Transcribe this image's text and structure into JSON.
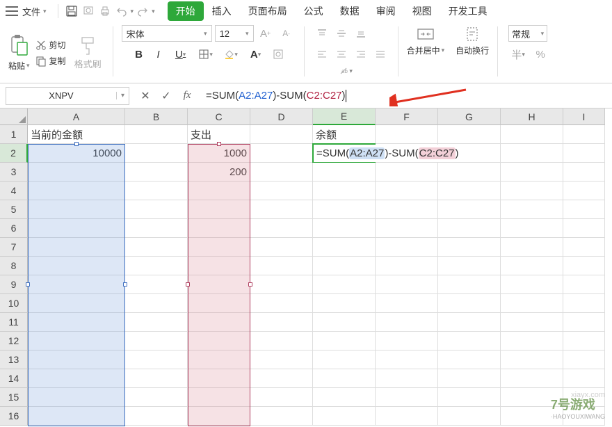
{
  "menu": {
    "file": "文件",
    "tabs": [
      "开始",
      "插入",
      "页面布局",
      "公式",
      "数据",
      "审阅",
      "视图",
      "开发工具"
    ],
    "active_tab": 0
  },
  "clipboard": {
    "paste": "粘贴",
    "cut": "剪切",
    "copy": "复制",
    "format_painter": "格式刷"
  },
  "font": {
    "name": "宋体",
    "size": "12",
    "bold": "B",
    "italic": "I",
    "underline": "U"
  },
  "merge": {
    "label": "合并居中"
  },
  "wrap": {
    "label": "自动换行"
  },
  "number_format": {
    "label": "常规",
    "currency_symbol": "半"
  },
  "formula_bar": {
    "name_box": "XNPV",
    "formula_pre": "=SUM(",
    "ref1": "A2:A27",
    "mid": ")-SUM(",
    "ref2": "C2:C27",
    "post": ")"
  },
  "columns": [
    "A",
    "B",
    "C",
    "D",
    "E",
    "F",
    "G",
    "H",
    "I"
  ],
  "active_col_index": 4,
  "rows": [
    "1",
    "2",
    "3",
    "4",
    "5",
    "6",
    "7",
    "8",
    "9",
    "10",
    "11",
    "12",
    "13",
    "14",
    "15",
    "16"
  ],
  "active_row_index": 1,
  "cells": {
    "A1": "当前的金额",
    "C1": "支出",
    "E1": "余额",
    "A2": "10000",
    "C2": "1000",
    "C3": "200"
  },
  "active_cell_display": {
    "pre": "=SUM(",
    "ref1": "A2:A27",
    "mid": ")-SUM(",
    "ref2": "C2:C27",
    "post": ")"
  },
  "watermark": {
    "brand": "7号游戏",
    "sub": "·HAOYOUXIWANG",
    "url": "xiayx.com"
  }
}
